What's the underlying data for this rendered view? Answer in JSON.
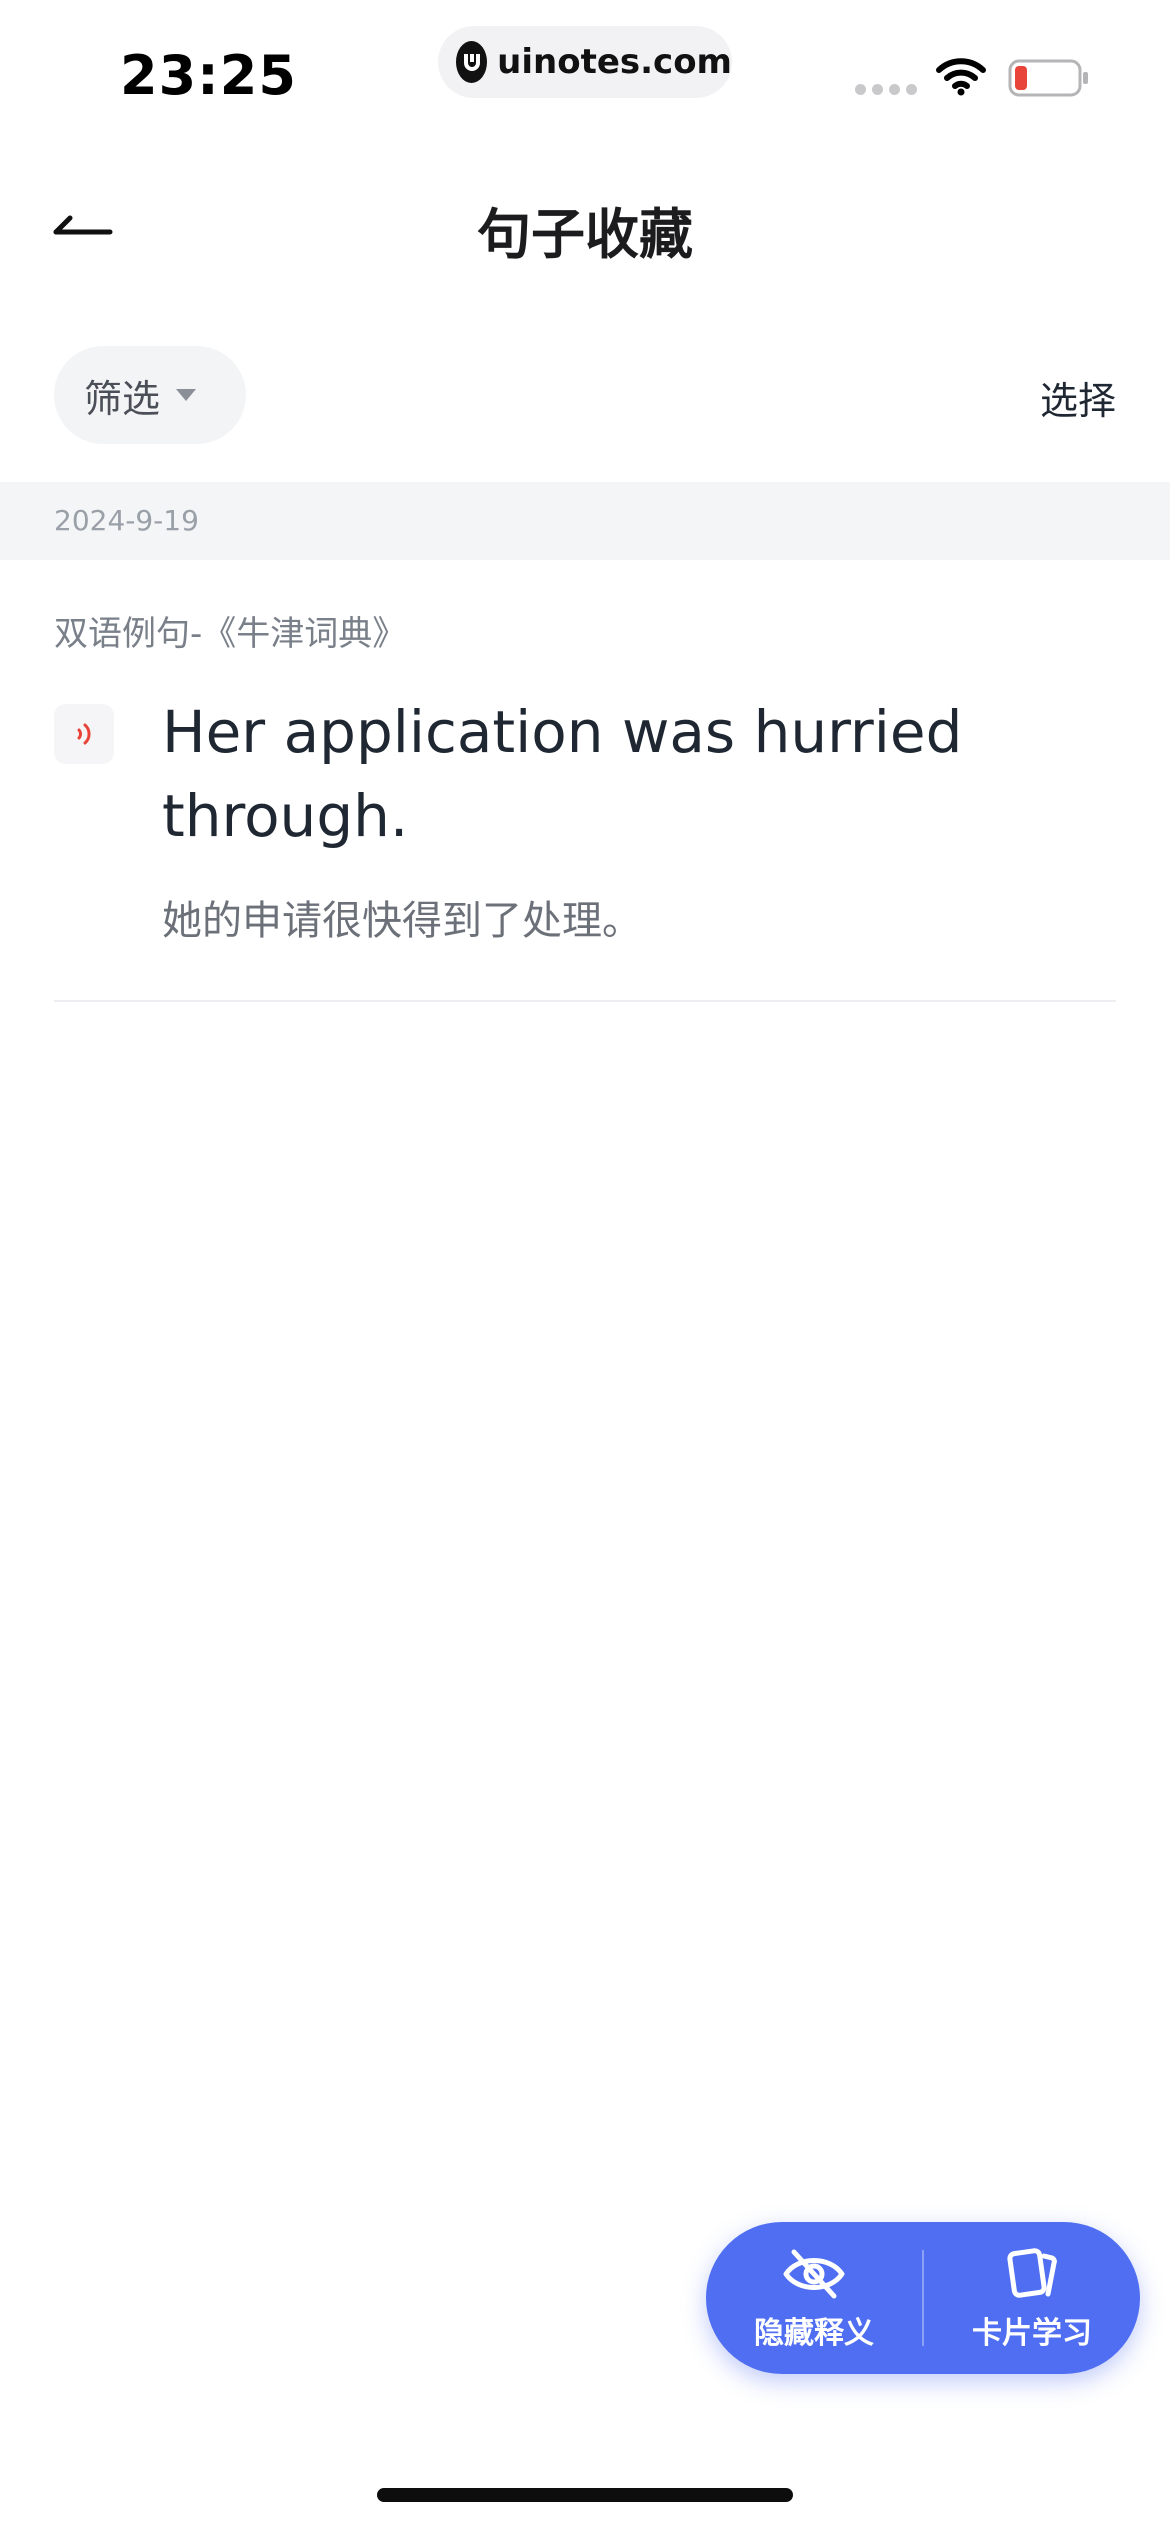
{
  "status": {
    "time": "23:25",
    "url": "uinotes.com",
    "icons": [
      "signal-icon",
      "wifi-icon",
      "battery-low-icon"
    ],
    "battery_color": "#e8443a"
  },
  "nav": {
    "title": "句子收藏",
    "back_icon": "back-arrow-icon"
  },
  "filter": {
    "label": "筛选",
    "select_label": "选择"
  },
  "list": {
    "date": "2024-9-19",
    "entries": [
      {
        "source": "双语例句-《牛津词典》",
        "sentence": "Her application was hurried through.",
        "translation": "她的申请很快得到了处理。"
      }
    ]
  },
  "actions": {
    "hide_label": "隐藏释义",
    "card_label": "卡片学习",
    "accent_color": "#4f6ef2"
  }
}
